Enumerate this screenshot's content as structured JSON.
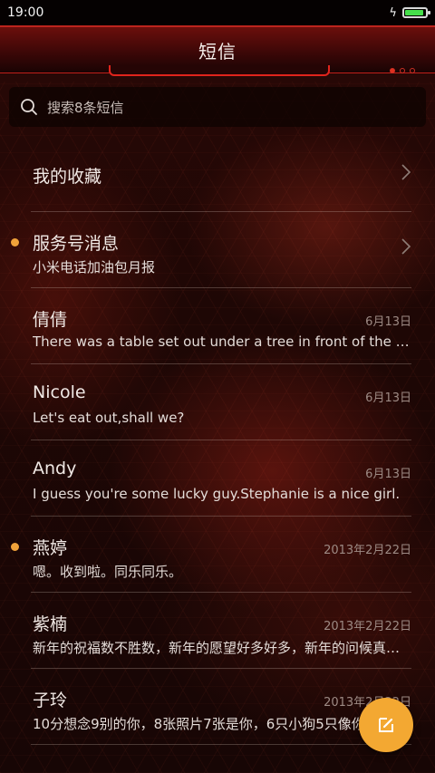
{
  "status_bar": {
    "time": "19:00",
    "battery_fraction": 0.9
  },
  "header": {
    "title": "短信",
    "page_dots": 3,
    "active_dot": 0
  },
  "search": {
    "placeholder": "搜索8条短信"
  },
  "threads": [
    {
      "name": "我的收藏",
      "snippet": "",
      "date": "",
      "unread": false,
      "chevron": true
    },
    {
      "name": "服务号消息",
      "snippet": "小米电话加油包月报",
      "date": "",
      "unread": true,
      "chevron": true
    },
    {
      "name": "倩倩",
      "snippet": "There was a table set out under a tree in front of the house",
      "date": "6月13日",
      "unread": false,
      "chevron": false
    },
    {
      "name": "Nicole",
      "snippet": "Let's eat out,shall we?",
      "date": "6月13日",
      "unread": false,
      "chevron": false
    },
    {
      "name": "Andy",
      "snippet": "I guess you're some lucky guy.Stephanie is a nice girl.",
      "date": "6月13日",
      "unread": false,
      "chevron": false
    },
    {
      "name": "燕婷",
      "snippet": "嗯。收到啦。同乐同乐。",
      "date": "2013年2月22日",
      "unread": true,
      "chevron": false
    },
    {
      "name": "紫楠",
      "snippet": "新年的祝福数不胜数，新年的愿望好多好多，新年的问候真真切切",
      "date": "2013年2月22日",
      "unread": false,
      "chevron": false
    },
    {
      "name": "子玲",
      "snippet": "10分想念9别的你，8张照片7张是你，6只小狗5只像你",
      "date": "2013年2月22日",
      "unread": false,
      "chevron": false
    }
  ],
  "colors": {
    "accent": "#e0241c",
    "unread_dot": "#f0a23a",
    "fab": "#f3a832"
  },
  "fab": {
    "icon": "compose-icon"
  }
}
